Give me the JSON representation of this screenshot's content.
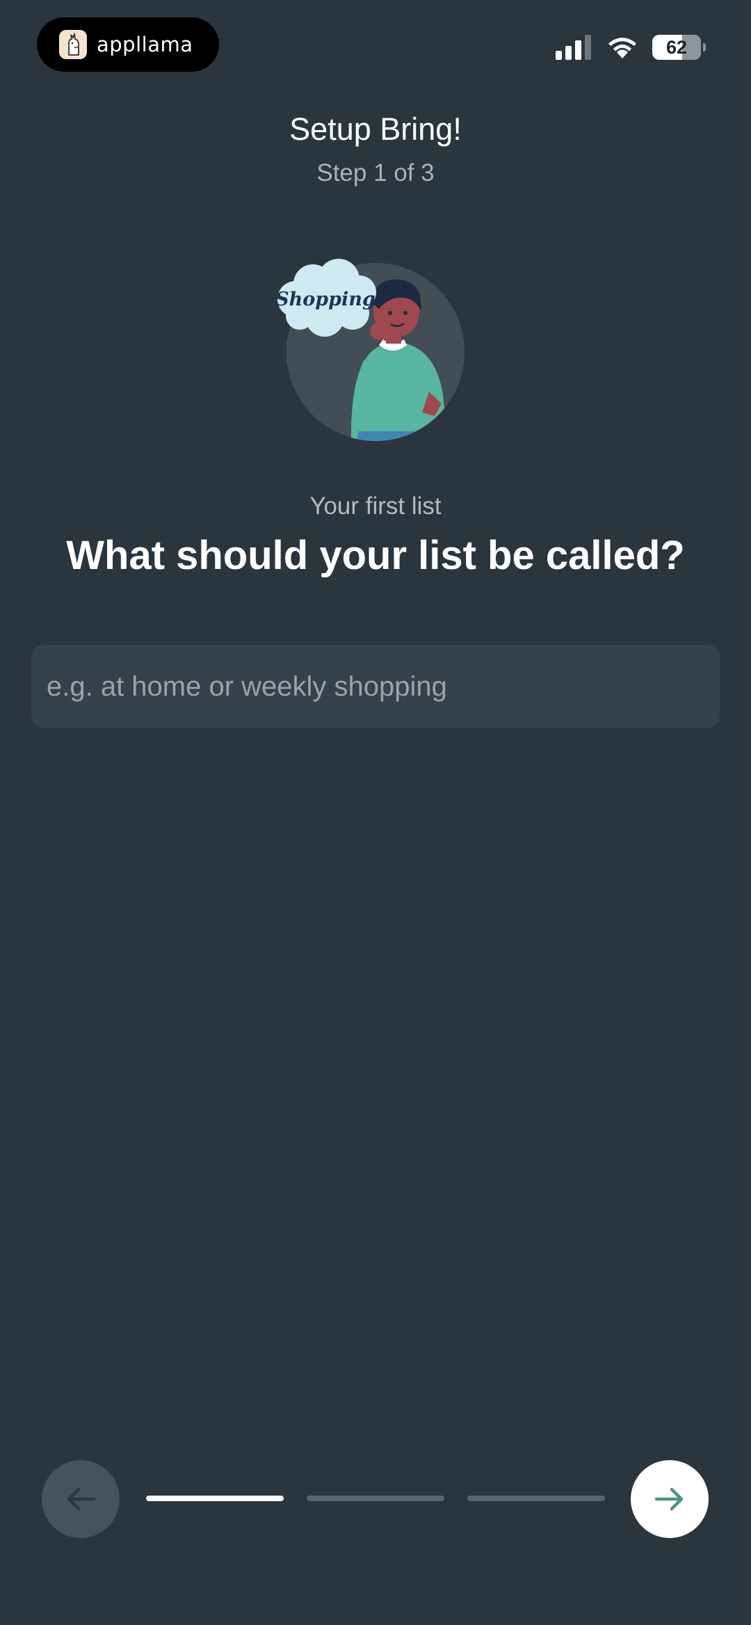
{
  "status_bar": {
    "brand_name": "appllama",
    "battery_level": "62",
    "icons": [
      "signal-icon",
      "wifi-icon",
      "battery-icon"
    ]
  },
  "header": {
    "title": "Setup Bring!",
    "step": "Step 1 of 3"
  },
  "illustration": {
    "cloud_text": "Shopping"
  },
  "prompt": {
    "subtitle": "Your first list",
    "title": "What should your list be called?"
  },
  "list_name_input": {
    "value": "",
    "placeholder": "e.g. at home or weekly shopping"
  },
  "navigation": {
    "total_steps": 3,
    "current_step": 1,
    "back_icon": "arrow-left-icon",
    "next_icon": "arrow-right-icon"
  },
  "colors": {
    "background": "#2b353e",
    "input_background": "#36414a",
    "accent": "#4a9585",
    "progress_active": "#ffffff",
    "progress_inactive": "#5b656e"
  }
}
